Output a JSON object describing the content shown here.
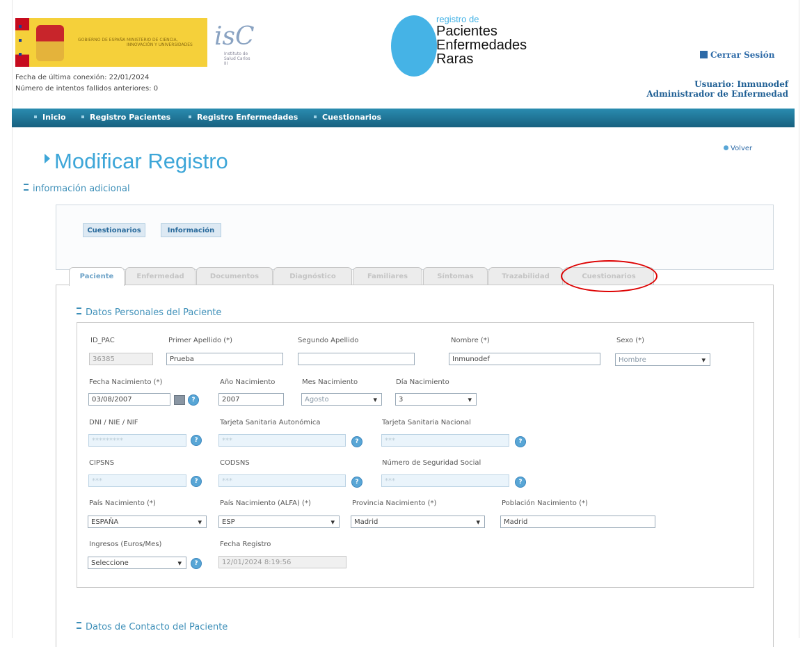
{
  "header": {
    "gov_line1": "GOBIERNO DE ESPAÑA",
    "gov_line2": "MINISTERIO DE CIENCIA, INNOVACIÓN Y UNIVERSIDADES",
    "isciii_mark": "isC",
    "isciii_text": "Instituto de Salud Carlos III",
    "registry_small": "registro de",
    "registry_line1": "Pacientes",
    "registry_line2": "Enfermedades",
    "registry_line3": "Raras",
    "logout": "Cerrar Sesión",
    "last_connection": "Fecha de última conexión: 22/01/2024",
    "failed_attempts": "Número de intentos fallidos anteriores: 0",
    "user": "Usuario: Inmunodef",
    "role": "Administrador de Enfermedad"
  },
  "nav": [
    "Inicio",
    "Registro Pacientes",
    "Registro Enfermedades",
    "Cuestionarios"
  ],
  "volver": "Volver",
  "page_title": "Modificar Registro",
  "additional_info": {
    "heading": "información adicional",
    "buttons": [
      "Cuestionarios",
      "Información"
    ]
  },
  "tabs": [
    "Paciente",
    "Enfermedad",
    "Documentos",
    "Diagnóstico",
    "Familiares",
    "Síntomas",
    "Trazabilidad",
    "Cuestionarios"
  ],
  "personal_section": "Datos Personales del Paciente",
  "contact_section": "Datos de Contacto del Paciente",
  "labels": {
    "id_pac": "ID_PAC",
    "primer_apellido": "Primer Apellido (*)",
    "segundo_apellido": "Segundo Apellido",
    "nombre": "Nombre (*)",
    "sexo": "Sexo (*)",
    "fecha_nac": "Fecha Nacimiento (*)",
    "anio_nac": "Año Nacimiento",
    "mes_nac": "Mes Nacimiento",
    "dia_nac": "Día Nacimiento",
    "dni": "DNI / NIE / NIF",
    "ts_autonomica": "Tarjeta Sanitaria Autonómica",
    "ts_nacional": "Tarjeta Sanitaria Nacional",
    "cipsns": "CIPSNS",
    "codsns": "CODSNS",
    "nss": "Número de Seguridad Social",
    "pais_nac": "País Nacimiento (*)",
    "pais_alfa": "País Nacimiento (ALFA) (*)",
    "provincia_nac": "Provincia Nacimiento (*)",
    "poblacion_nac": "Población Nacimiento (*)",
    "ingresos": "Ingresos (Euros/Mes)",
    "fecha_registro": "Fecha Registro"
  },
  "values": {
    "id_pac": "36385",
    "primer_apellido": "Prueba",
    "segundo_apellido": "",
    "nombre": "Inmunodef",
    "sexo": "Hombre",
    "fecha_nac": "03/08/2007",
    "anio_nac": "2007",
    "mes_nac": "Agosto",
    "dia_nac": "3",
    "dni": "*********",
    "ts_autonomica": "***",
    "ts_nacional": "***",
    "cipsns": "***",
    "codsns": "***",
    "nss": "***",
    "pais_nac": "ESPAÑA",
    "pais_alfa": "ESP",
    "provincia_nac": "Madrid",
    "poblacion_nac": "Madrid",
    "ingresos": "Seleccione",
    "fecha_registro": "12/01/2024 8:19:56"
  },
  "help_symbol": "?",
  "colors": {
    "accent": "#3da6d8",
    "nav": "#17607f",
    "highlight": "#dd0000"
  }
}
